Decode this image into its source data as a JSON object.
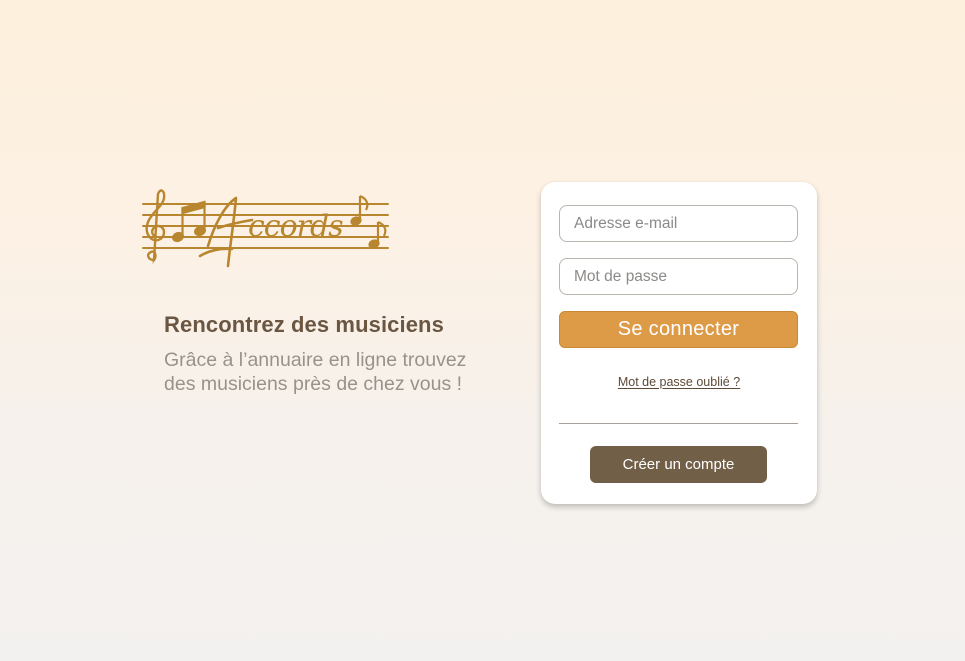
{
  "brand": {
    "logo_text": "Accords",
    "logo_color": "#b8862f"
  },
  "hero": {
    "title": "Rencontrez des musiciens",
    "description": "Grâce à l’annuaire en ligne trouvez des musiciens près de chez vous !"
  },
  "login": {
    "email_placeholder": "Adresse e-mail",
    "password_placeholder": "Mot de passe",
    "submit_label": "Se connecter",
    "forgot_label": "Mot de passe oublié ?",
    "create_label": "Créer un compte"
  },
  "colors": {
    "accent": "#dd9a47",
    "secondary": "#725f47",
    "heading": "#6b5741",
    "muted_text": "#9a928a"
  },
  "icons": [
    "treble-clef-icon",
    "music-note-icon"
  ]
}
